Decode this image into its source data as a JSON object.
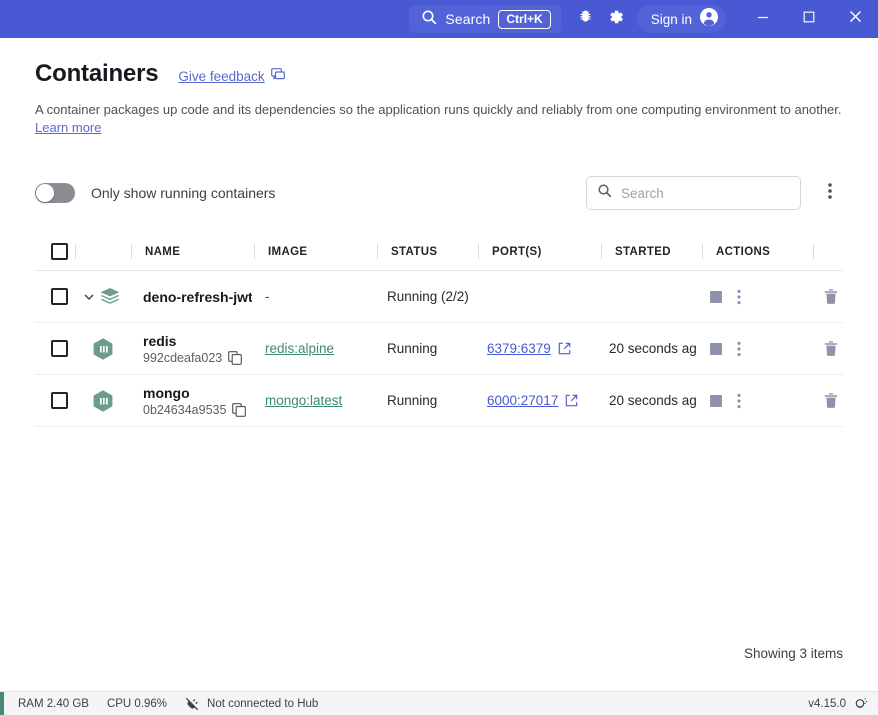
{
  "titlebar": {
    "search_label": "Search",
    "shortcut": "Ctrl+K",
    "bug_icon": "bug-icon",
    "settings_icon": "gear-icon",
    "signin_label": "Sign in",
    "minimize": "minimize-icon",
    "maximize": "maximize-icon",
    "close": "close-icon",
    "bg_color": "#4959d3",
    "pill_color": "#5263d8"
  },
  "header": {
    "title": "Containers",
    "feedback_label": "Give feedback",
    "description_before": "A container packages up code and its dependencies so the application runs quickly and reliably from one computing environment to another.",
    "learn_more": "Learn more",
    "link_color": "#5969d1"
  },
  "filters": {
    "toggle_label": "Only show running containers",
    "toggle_on": false,
    "search_placeholder": "Search",
    "search_value": "",
    "overflow_icon": "kebab-menu-icon"
  },
  "table": {
    "columns": [
      "",
      "",
      "NAME",
      "IMAGE",
      "STATUS",
      "PORT(S)",
      "STARTED",
      "ACTIONS"
    ],
    "headers": {
      "name": "NAME",
      "image": "IMAGE",
      "status": "STATUS",
      "ports": "PORT(S)",
      "started": "STARTED",
      "actions": "ACTIONS"
    },
    "rows": [
      {
        "type": "stack",
        "icon": "stack-layers-icon",
        "expanded": true,
        "name": "deno-refresh-jwt",
        "container_id": "",
        "image": "-",
        "image_is_link": false,
        "status": "Running (2/2)",
        "ports": "",
        "started": "",
        "has_stop": true,
        "has_kebab": true,
        "has_delete": true
      },
      {
        "type": "container",
        "icon": "container-box-icon",
        "expanded": false,
        "name": "redis",
        "container_id": "992cdeafa023",
        "image": "redis:alpine",
        "image_is_link": true,
        "status": "Running",
        "ports": "6379:6379",
        "started": "20 seconds ag",
        "has_stop": true,
        "has_kebab": true,
        "has_delete": true
      },
      {
        "type": "container",
        "icon": "container-box-icon",
        "expanded": false,
        "name": "mongo",
        "container_id": "0b24634a9535",
        "image": "mongo:latest",
        "image_is_link": true,
        "status": "Running",
        "ports": "6000:27017",
        "started": "20 seconds ag",
        "has_stop": true,
        "has_kebab": true,
        "has_delete": true
      }
    ],
    "footer_count": "Showing 3 items",
    "image_link_color": "#3a8a77",
    "port_link_color": "#4959d3",
    "container_icon_color": "#6a9e8a"
  },
  "statusbar": {
    "ram": "RAM 2.40 GB",
    "cpu": "CPU 0.96%",
    "hub_status": "Not connected to Hub",
    "hub_icon": "plug-disconnected-icon",
    "version": "v4.15.0",
    "tip_icon": "lightbulb-icon",
    "accent_color": "#4a8a73"
  }
}
